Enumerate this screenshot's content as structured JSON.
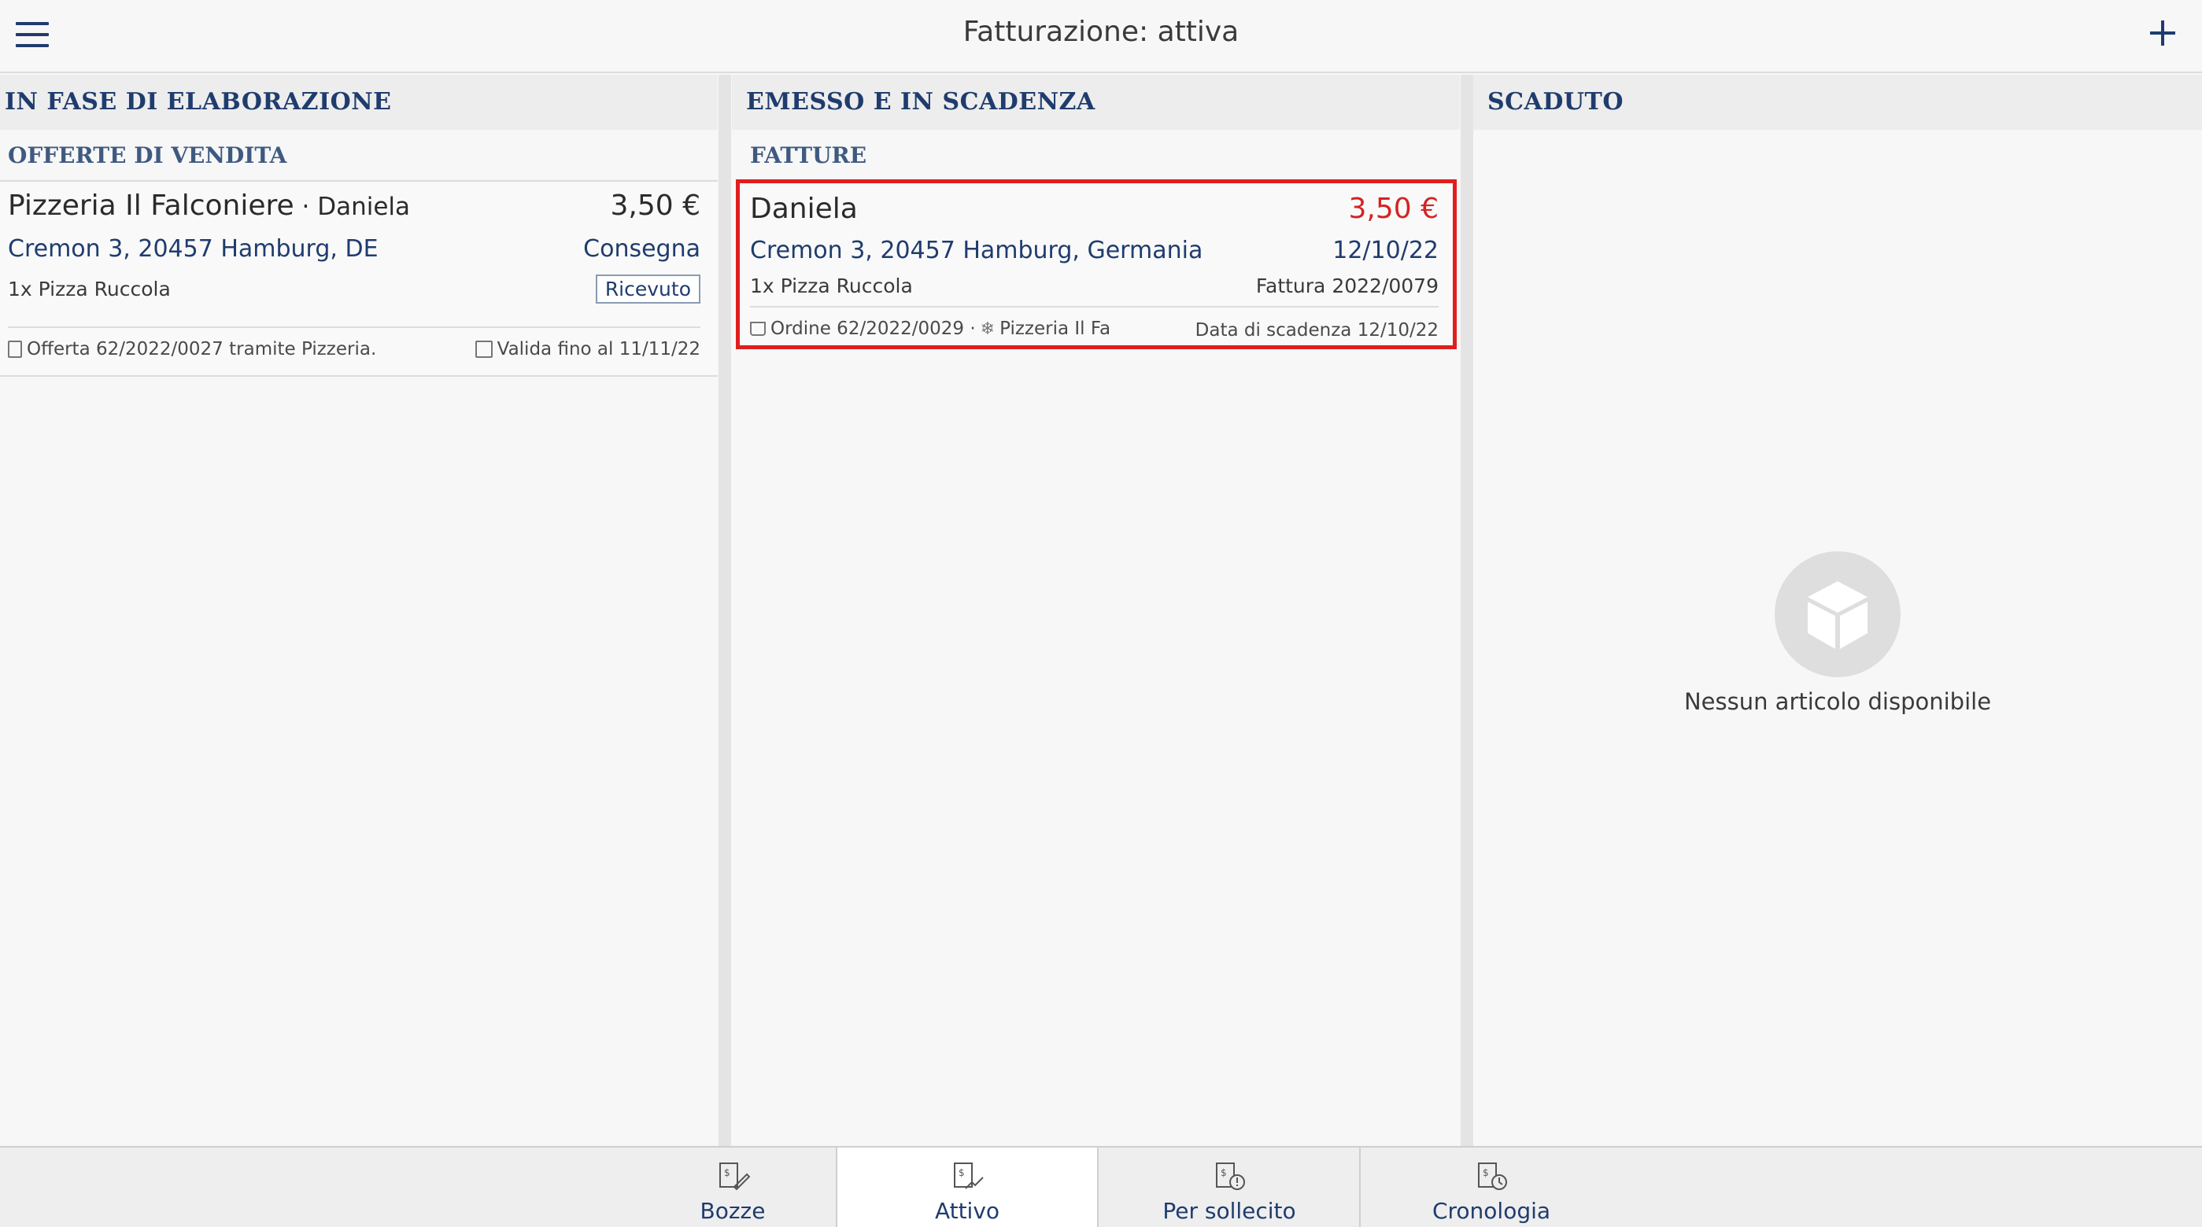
{
  "header": {
    "title": "Fatturazione: attiva"
  },
  "columns": {
    "processing": {
      "title": "IN FASE DI ELABORAZIONE",
      "section": "OFFERTE DI VENDITA",
      "card": {
        "name": "Pizzeria Il Falconiere",
        "contact": " · Daniela",
        "amount": "3,50 €",
        "address": "Cremon 3, 20457 Hamburg, DE",
        "delivery": "Consegna",
        "items": "1x Pizza Ruccola",
        "status": "Ricevuto",
        "offer_ref": "Offerta 62/2022/0027 tramite Pizzeria.",
        "valid_until": "Valida fino al 11/11/22"
      }
    },
    "issued": {
      "title": "EMESSO E IN SCADENZA",
      "section": "FATTURE",
      "card": {
        "name": "Daniela",
        "amount": "3,50 €",
        "address": "Cremon 3, 20457 Hamburg, Germania",
        "date": "12/10/22",
        "items": "1x Pizza Ruccola",
        "invoice_ref": "Fattura 2022/0079",
        "order_ref": "Ordine 62/2022/0029 · ",
        "source": "Pizzeria Il Fa",
        "due_date": "Data di scadenza 12/10/22"
      }
    },
    "expired": {
      "title": "SCADUTO",
      "empty_text": "Nessun articolo disponibile"
    }
  },
  "tabs": [
    {
      "label": "Bozze",
      "icon": "invoice-draft-icon"
    },
    {
      "label": "Attivo",
      "icon": "invoice-active-icon",
      "active": true
    },
    {
      "label": "Per sollecito",
      "icon": "invoice-reminder-icon"
    },
    {
      "label": "Cronologia",
      "icon": "invoice-history-icon"
    }
  ],
  "colors": {
    "accent": "#1f3c6e",
    "highlight": "#e01e1e",
    "amount_due": "#d42323"
  }
}
